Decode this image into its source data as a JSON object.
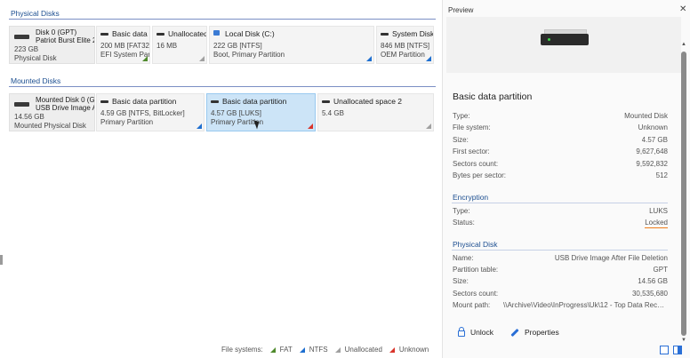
{
  "physical_disks": {
    "title": "Physical Disks",
    "disk": {
      "name": "Disk 0 (GPT)",
      "model": "Patriot Burst Elite 24",
      "size": "223 GB",
      "kind": "Physical Disk"
    },
    "partitions": [
      {
        "name": "Basic data pa",
        "size": "200 MB [FAT32]",
        "type": "EFI System Part",
        "fs_color": "green"
      },
      {
        "name": "Unallocated",
        "size": "16 MB",
        "type": "",
        "fs_color": "gray"
      },
      {
        "name": "Local Disk (C:)",
        "size": "222 GB [NTFS]",
        "type": "Boot, Primary Partition",
        "fs_color": "blue"
      },
      {
        "name": "System Disk",
        "size": "846 MB [NTFS]",
        "type": "OEM Partition",
        "fs_color": "blue"
      }
    ]
  },
  "mounted_disks": {
    "title": "Mounted Disks",
    "disk": {
      "name": "Mounted Disk 0 (GP",
      "model": "USB Drive Image Aft",
      "size": "14.56 GB",
      "kind": "Mounted Physical Disk"
    },
    "partitions": [
      {
        "name": "Basic data partition",
        "size": "4.59 GB [NTFS, BitLocker]",
        "type": "Primary Partition",
        "fs_color": "blue"
      },
      {
        "name": "Basic data partition",
        "size": "4.57 GB [LUKS]",
        "type": "Primary Partition",
        "fs_color": "red",
        "selected": true
      },
      {
        "name": "Unallocated space 2",
        "size": "5.4 GB",
        "type": "",
        "fs_color": "gray"
      }
    ]
  },
  "legend": {
    "label": "File systems:",
    "items": [
      {
        "name": "FAT",
        "color": "#4f8a2c"
      },
      {
        "name": "NTFS",
        "color": "#1e6fd0"
      },
      {
        "name": "Unallocated",
        "color": "#a0a0a0"
      },
      {
        "name": "Unknown",
        "color": "#d9342b"
      }
    ]
  },
  "preview": {
    "title": "Preview",
    "close": "✕",
    "heading": "Basic data partition",
    "general": [
      {
        "label": "Type:",
        "value": "Mounted Disk"
      },
      {
        "label": "File system:",
        "value": "Unknown"
      },
      {
        "label": "Size:",
        "value": "4.57 GB"
      },
      {
        "label": "First sector:",
        "value": "9,627,648"
      },
      {
        "label": "Sectors count:",
        "value": "9,592,832"
      },
      {
        "label": "Bytes per sector:",
        "value": "512"
      }
    ],
    "encryption": {
      "title": "Encryption",
      "rows": [
        {
          "label": "Type:",
          "value": "LUKS"
        },
        {
          "label": "Status:",
          "value": "Locked"
        }
      ]
    },
    "physical_disk": {
      "title": "Physical Disk",
      "rows": [
        {
          "label": "Name:",
          "value": "USB Drive Image After File Deletion"
        },
        {
          "label": "Partition table:",
          "value": "GPT"
        },
        {
          "label": "Size:",
          "value": "14.56 GB"
        },
        {
          "label": "Sectors count:",
          "value": "30,535,680"
        },
        {
          "label": "Mount path:",
          "value": "\\\\Archive\\Video\\InProgress\\Uk\\12 - Top Data Recove..."
        }
      ]
    },
    "actions": {
      "unlock": "Unlock",
      "properties": "Properties"
    }
  },
  "colors": {
    "accent": "#1d4f91",
    "selected_bg": "#cce4f7",
    "locked_underline": "#ef7d1a"
  }
}
